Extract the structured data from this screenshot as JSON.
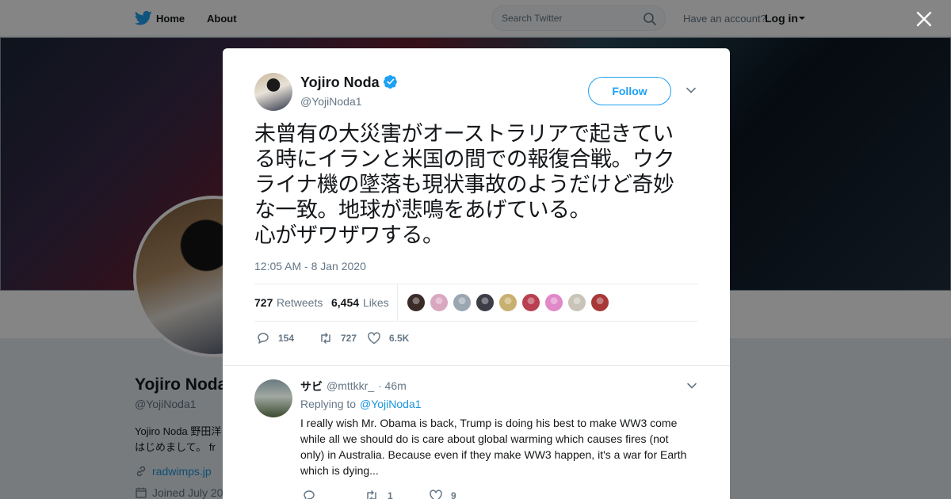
{
  "topbar": {
    "nav_home": "Home",
    "nav_about": "About",
    "search_placeholder": "Search Twitter",
    "account_question": "Have an account?",
    "login": "Log in"
  },
  "profile": {
    "name": "Yojiro Noda",
    "handle": "@YojiNoda1",
    "bio_line1": "Yojiro Noda 野田洋",
    "bio_line2": "はじめまして。 fr",
    "link": "radwimps.jp",
    "joined": "Joined July 20"
  },
  "tweet": {
    "author_name": "Yojiro Noda",
    "author_handle": "@YojiNoda1",
    "follow_label": "Follow",
    "text_lines": [
      "未曾有の大災害がオーストラリアで起きてい",
      "る時にイランと米国の間での報復合戦。ウク",
      "ライナ機の墜落も現状事故のようだけど奇妙",
      "な一致。地球が悲鳴をあげている。",
      "心がザワザワする。"
    ],
    "timestamp": "12:05 AM - 8 Jan 2020",
    "retweets_count": "727",
    "retweets_label": "Retweets",
    "likes_count": "6,454",
    "likes_label": "Likes",
    "likers": [
      "#3a2a28",
      "#d9a8c0",
      "#9aa6b2",
      "#3d3d48",
      "#c8b070",
      "#b84050",
      "#e088c8",
      "#c8c4b8",
      "#a83838"
    ],
    "actions": {
      "replies": "154",
      "retweets": "727",
      "likes": "6.5K"
    },
    "verified_color": "#1da1f2"
  },
  "reply": {
    "name": "サビ",
    "handle": "@mttkkr_",
    "time": "· 46m",
    "replying_label": "Replying to",
    "replying_to": "@YojiNoda1",
    "text_lines": [
      "I really wish Mr. Obama is back, Trump is doing his best to make WW3 come",
      "while all we should do is care about global warming which causes fires (not",
      "only) in Australia. Because even if they make WW3 happen, it's a war for Earth",
      "which is dying..."
    ],
    "actions": {
      "replies": "",
      "retweets": "1",
      "likes": "9"
    }
  },
  "colors": {
    "accent": "#1da1f2",
    "link": "#1b95e0",
    "muted": "#657786"
  }
}
